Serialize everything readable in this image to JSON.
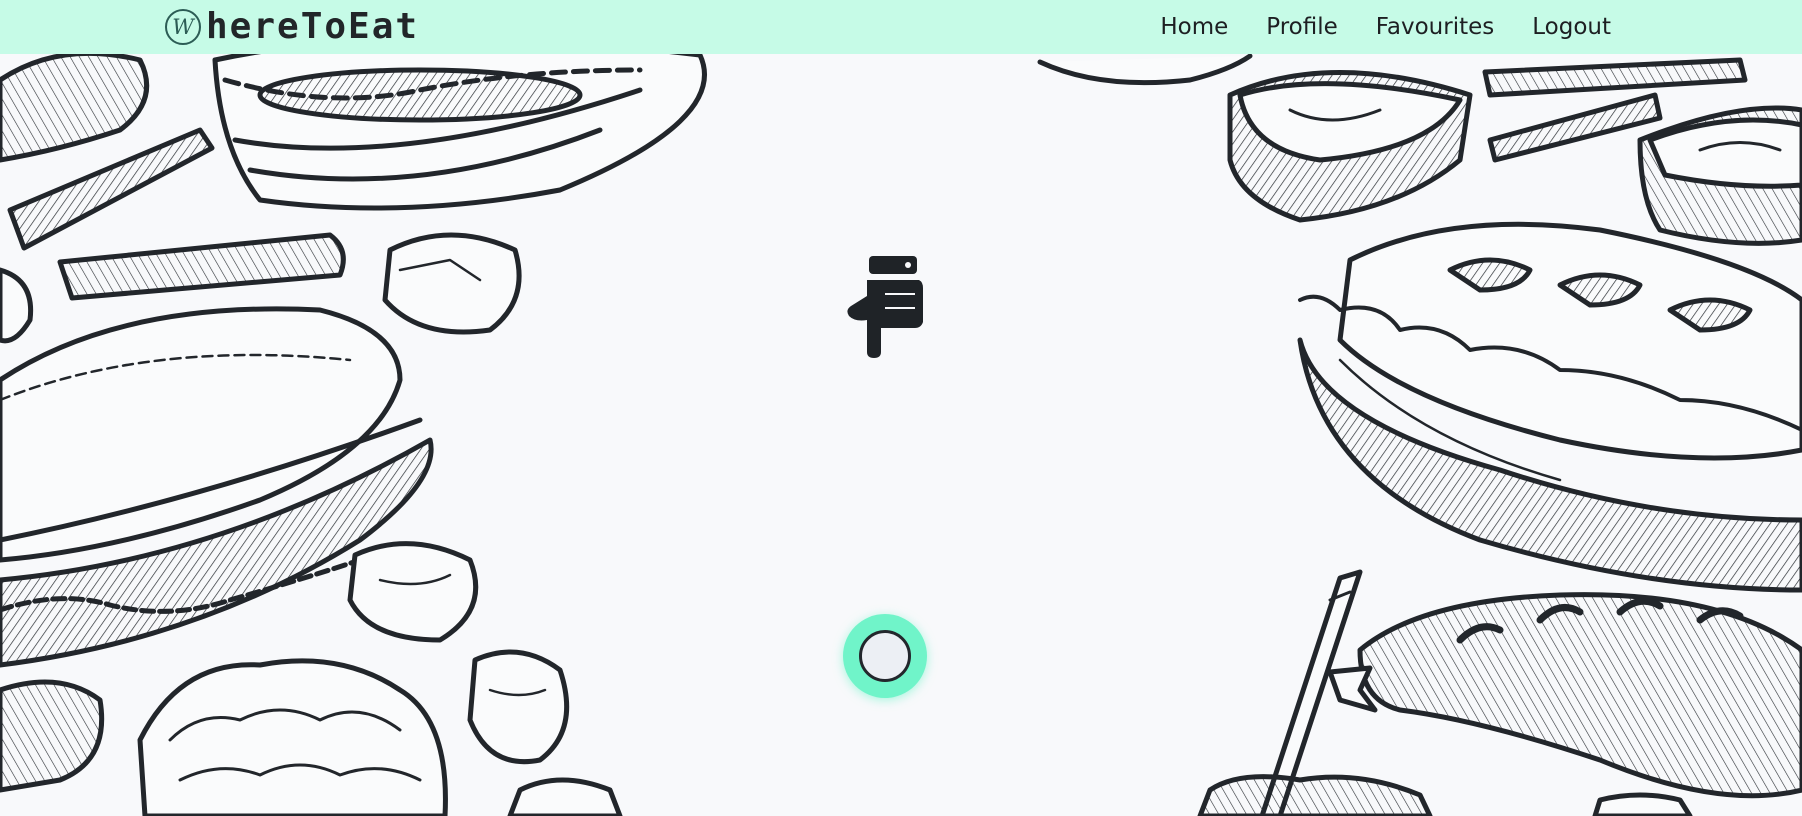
{
  "navbar": {
    "logo_letter": "W",
    "brand": "hereToEat",
    "links": [
      "Home",
      "Profile",
      "Favourites",
      "Logout"
    ],
    "bg_color": "#c6fbe7"
  },
  "main": {
    "pointer_icon": "hand-pointing-down-icon",
    "action_button_color": "#70f4c9"
  }
}
